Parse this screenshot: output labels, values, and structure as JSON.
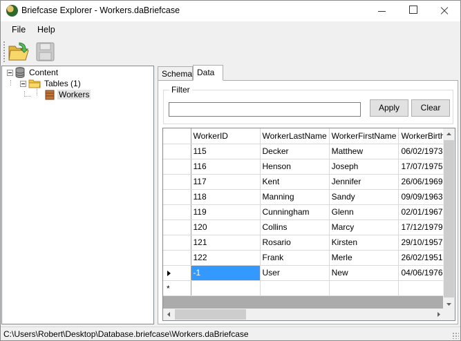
{
  "window": {
    "title": "Briefcase Explorer - Workers.daBriefcase"
  },
  "menu": {
    "items": [
      "File",
      "Help"
    ]
  },
  "toolbar": {
    "buttons": [
      {
        "icon": "open-folder-icon"
      },
      {
        "icon": "save-disk-icon"
      }
    ]
  },
  "tree": {
    "root": "Content",
    "tables": "Tables (1)",
    "table": "Workers"
  },
  "tabs": [
    "Schema",
    "Data"
  ],
  "filter": {
    "group_title": "Filter",
    "value": "",
    "apply_label": "Apply",
    "clear_label": "Clear"
  },
  "grid": {
    "columns": [
      "WorkerID",
      "WorkerLastName",
      "WorkerFirstName",
      "WorkerBirthD"
    ],
    "rows": [
      [
        "115",
        "Decker",
        "Matthew",
        "06/02/1973"
      ],
      [
        "116",
        "Henson",
        "Joseph",
        "17/07/1975"
      ],
      [
        "117",
        "Kent",
        "Jennifer",
        "26/06/1969"
      ],
      [
        "118",
        "Manning",
        "Sandy",
        "09/09/1963"
      ],
      [
        "119",
        "Cunningham",
        "Glenn",
        "02/01/1967"
      ],
      [
        "120",
        "Collins",
        "Marcy",
        "17/12/1979"
      ],
      [
        "121",
        "Rosario",
        "Kirsten",
        "29/10/1957"
      ],
      [
        "122",
        "Frank",
        "Merle",
        "26/02/1951"
      ],
      [
        "-1",
        "User",
        "New",
        "04/06/1976"
      ]
    ],
    "new_row_marker": "*"
  },
  "status": {
    "path": "C:\\Users\\Robert\\Desktop\\Database.briefcase\\Workers.daBriefcase"
  },
  "colors": {
    "selection": "#3399ff",
    "folder": "#f5c542",
    "table_icon": "#c0743a"
  }
}
